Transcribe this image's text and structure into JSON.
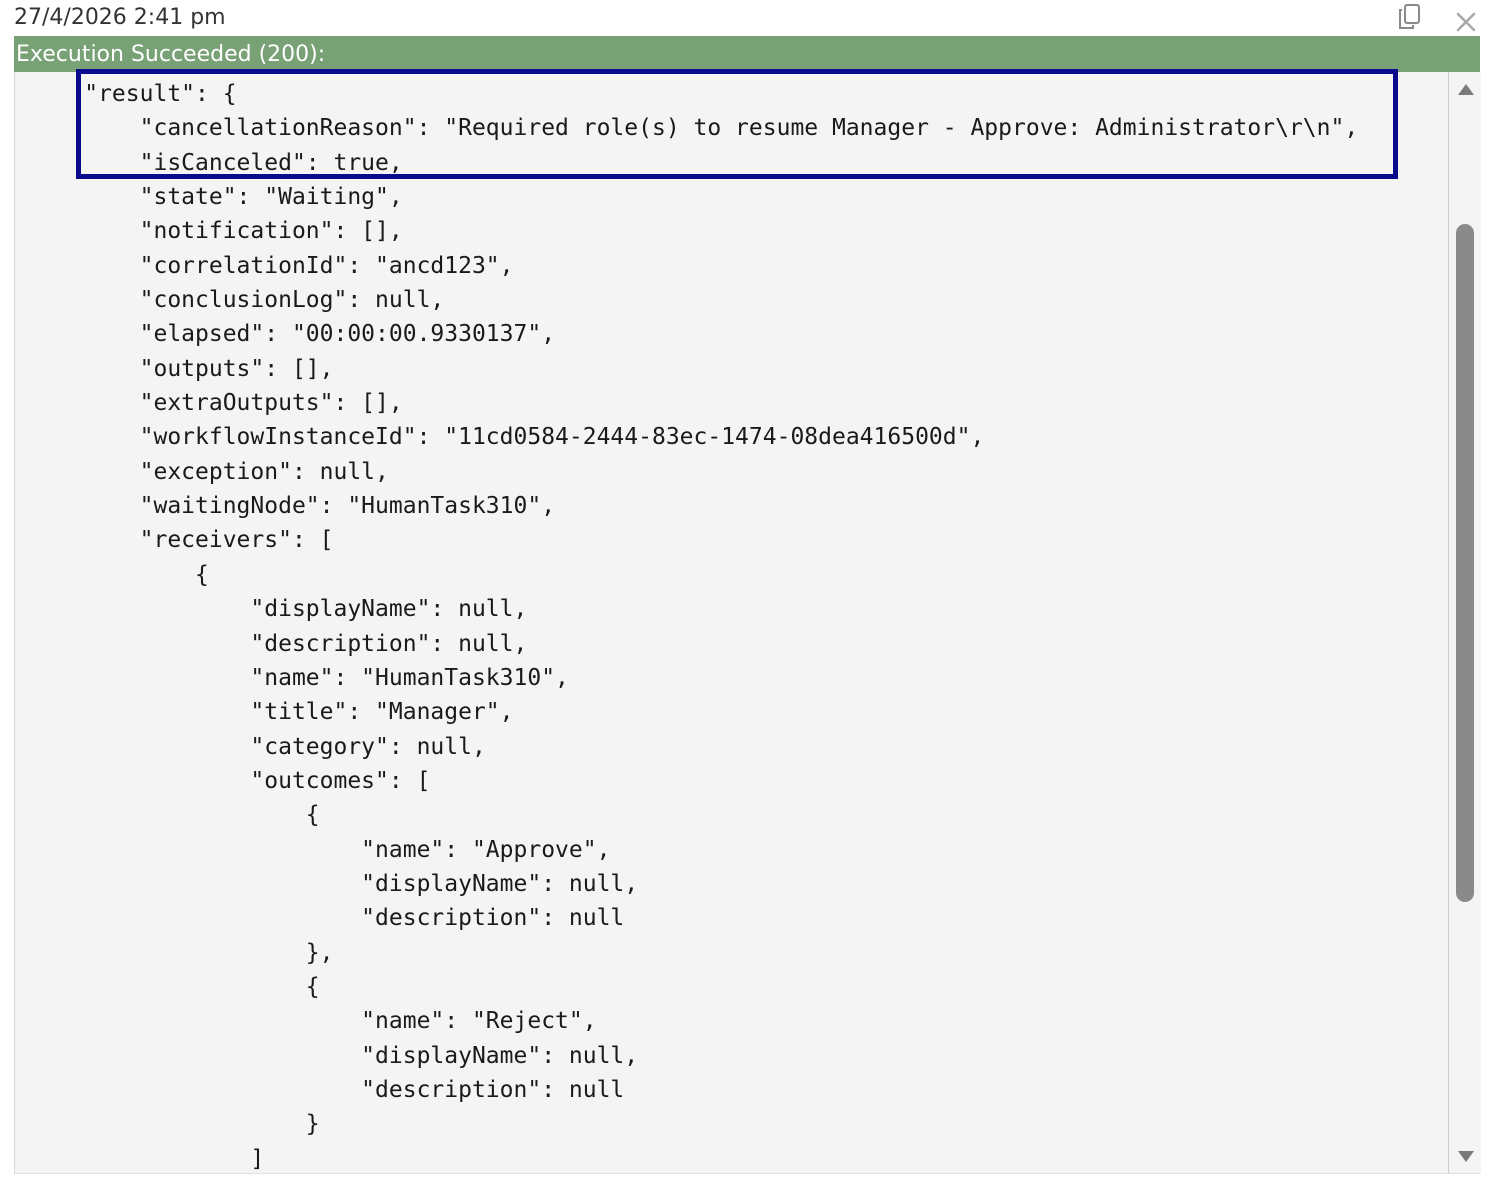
{
  "header": {
    "timestamp": "27/4/2026 2:41 pm",
    "copy_icon": "copy-icon",
    "close_icon": "close-icon"
  },
  "status": {
    "text": "Execution Succeeded (200):",
    "color": "#78a176"
  },
  "highlight": {
    "color": "#0a0a8c"
  },
  "code": {
    "lines": [
      "     \"result\": {",
      "         \"cancellationReason\": \"Required role(s) to resume Manager - Approve: Administrator\\r\\n\",",
      "         \"isCanceled\": true,",
      "         \"state\": \"Waiting\",",
      "         \"notification\": [],",
      "         \"correlationId\": \"ancd123\",",
      "         \"conclusionLog\": null,",
      "         \"elapsed\": \"00:00:00.9330137\",",
      "         \"outputs\": [],",
      "         \"extraOutputs\": [],",
      "         \"workflowInstanceId\": \"11cd0584-2444-83ec-1474-08dea416500d\",",
      "         \"exception\": null,",
      "         \"waitingNode\": \"HumanTask310\",",
      "         \"receivers\": [",
      "             {",
      "                 \"displayName\": null,",
      "                 \"description\": null,",
      "                 \"name\": \"HumanTask310\",",
      "                 \"title\": \"Manager\",",
      "                 \"category\": null,",
      "                 \"outcomes\": [",
      "                     {",
      "                         \"name\": \"Approve\",",
      "                         \"displayName\": null,",
      "                         \"description\": null",
      "                     },",
      "                     {",
      "                         \"name\": \"Reject\",",
      "                         \"displayName\": null,",
      "                         \"description\": null",
      "                     }",
      "                 ]"
    ]
  }
}
